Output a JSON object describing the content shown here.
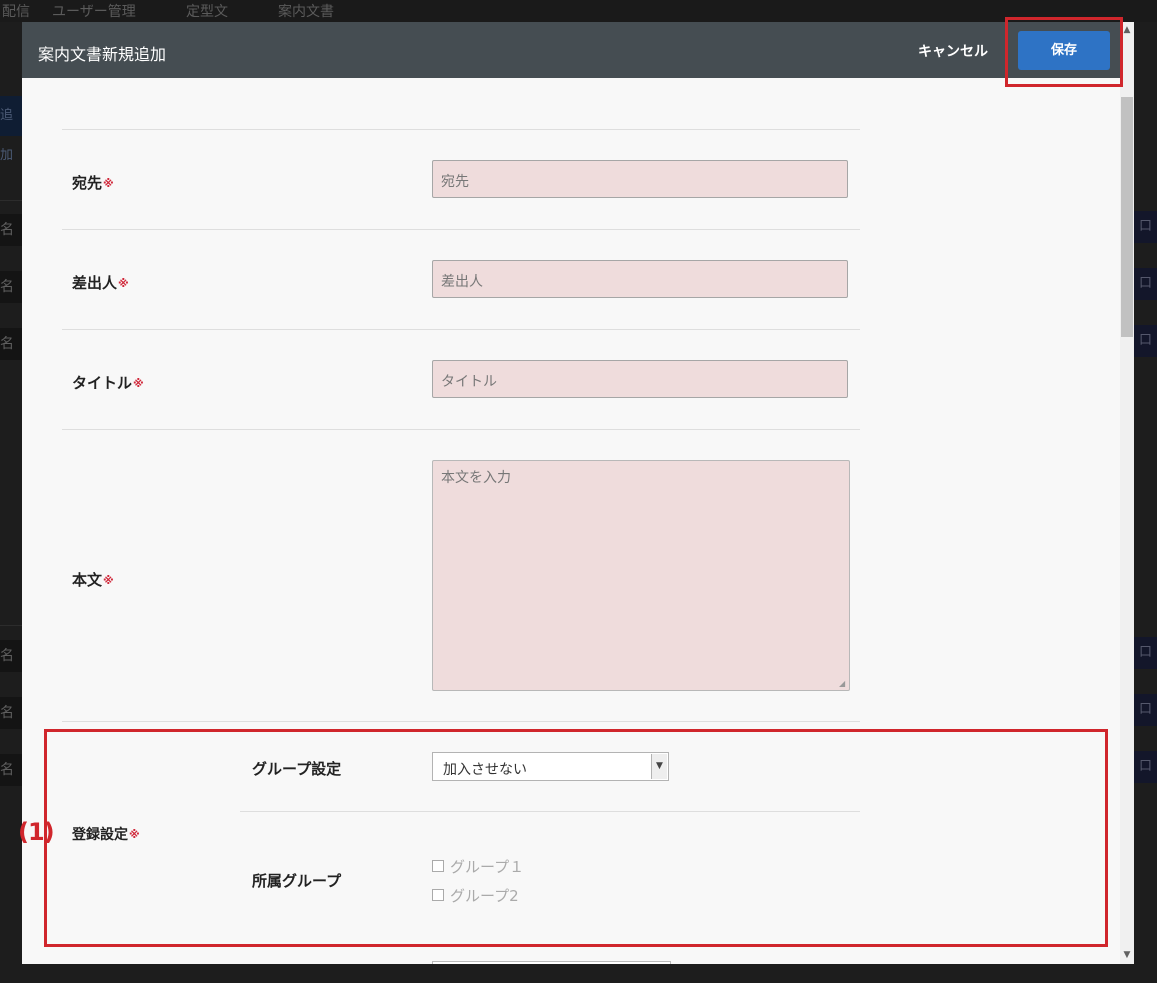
{
  "background": {
    "nav_items": [
      "配信",
      "ユーザー管理",
      "定型文",
      "案内文書"
    ],
    "side_marks": [
      "追加",
      "名",
      "名",
      "名",
      "名",
      "名",
      "名"
    ],
    "right_mark": "口"
  },
  "modal": {
    "title": "案内文書新規追加",
    "cancel_label": "キャンセル",
    "save_label": "保存",
    "required_mark": "※",
    "fields": {
      "recipient": {
        "label": "宛先",
        "placeholder": "宛先"
      },
      "sender": {
        "label": "差出人",
        "placeholder": "差出人"
      },
      "title": {
        "label": "タイトル",
        "placeholder": "タイトル"
      },
      "body": {
        "label": "本文",
        "placeholder": "本文を入力"
      }
    },
    "registration": {
      "label": "登録設定",
      "group_setting": {
        "label": "グループ設定",
        "selected": "加入させない"
      },
      "affiliated_groups": {
        "label": "所属グループ",
        "options": [
          "グループ１",
          "グループ2"
        ]
      }
    }
  },
  "annotation": {
    "callout": "(1)"
  },
  "colors": {
    "accent": "#2e73c5",
    "highlight": "#d0262c",
    "header": "#454d52",
    "field_bg": "#efdcdc"
  },
  "icons": {
    "dropdown": "chevron-down-icon",
    "scroll_up": "scroll-up-icon",
    "scroll_down": "scroll-down-icon"
  }
}
